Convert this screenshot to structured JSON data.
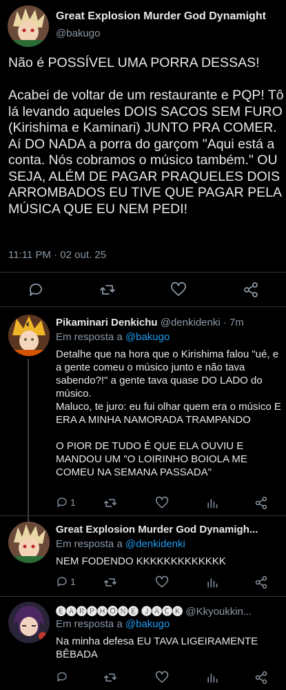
{
  "main_tweet": {
    "display_name": "Great Explosion Murder God Dynamight",
    "handle": "@bakugo",
    "text": "Não é POSSÍVEL UMA PORRA DESSAS!\n\nAcabei de voltar de um restaurante e PQP! Tô lá levando aqueles DOIS SACOS SEM FURO (Kirishima e Kaminari) JUNTO PRA COMER. Aí DO NADA a porra do garçom \"Aqui está a conta. Nós cobramos o músico também.\" OU SEJA, ALÉM DE PAGAR PRAQUELES DOIS ARROMBADOS EU TIVE QUE PAGAR PELA MÚSICA QUE EU NEM PEDI!",
    "timestamp": "11:11 PM · 02 out. 25",
    "actions": [
      "reply-icon",
      "retweet-icon",
      "like-icon",
      "share-icon"
    ]
  },
  "replies": [
    {
      "display_name": "Pikaminari Denkichu",
      "handle_time": "@denkidenki · 7m",
      "in_reply_prefix": "Em resposta a",
      "in_reply_to": "@bakugo",
      "text": "Detalhe que na hora que o Kirishima falou \"ué, e a gente comeu o músico junto e não tava sabendo?!\" a gente tava quase DO LADO do músico.\nMaluco, te juro: eu fui olhar quem era o músico E ERA A MINHA NAMORADA TRAMPANDO\n\nO PIOR DE TUDO É QUE ELA OUVIU E MANDOU UM \"O LOIRINHO BOIOLA ME COMEU NA SEMANA PASSADA\"",
      "reply_count": "1"
    },
    {
      "display_name": "Great Explosion Murder God Dynamigh...",
      "handle_time": "",
      "in_reply_prefix": "Em resposta a",
      "in_reply_to": "@denkidenki",
      "text": "NEM FODENDO KKKKKKKKKKKKK",
      "reply_count": "1"
    },
    {
      "display_name": "🅔🅐🅡🅟🅗🅞🅝🅔 🅙🅐🅒🅚",
      "handle_time": "@Kkyoukkin...",
      "in_reply_prefix": "Em resposta a",
      "in_reply_to": "@bakugo",
      "text": "Na minha defesa EU TAVA LIGEIRAMENTE BÊBADA",
      "reply_count": ""
    }
  ],
  "colors": {
    "background": "#000000",
    "text": "#e7e9ea",
    "muted": "#8b98a5",
    "link": "#1d9bf0",
    "separator": "#2f3336"
  }
}
